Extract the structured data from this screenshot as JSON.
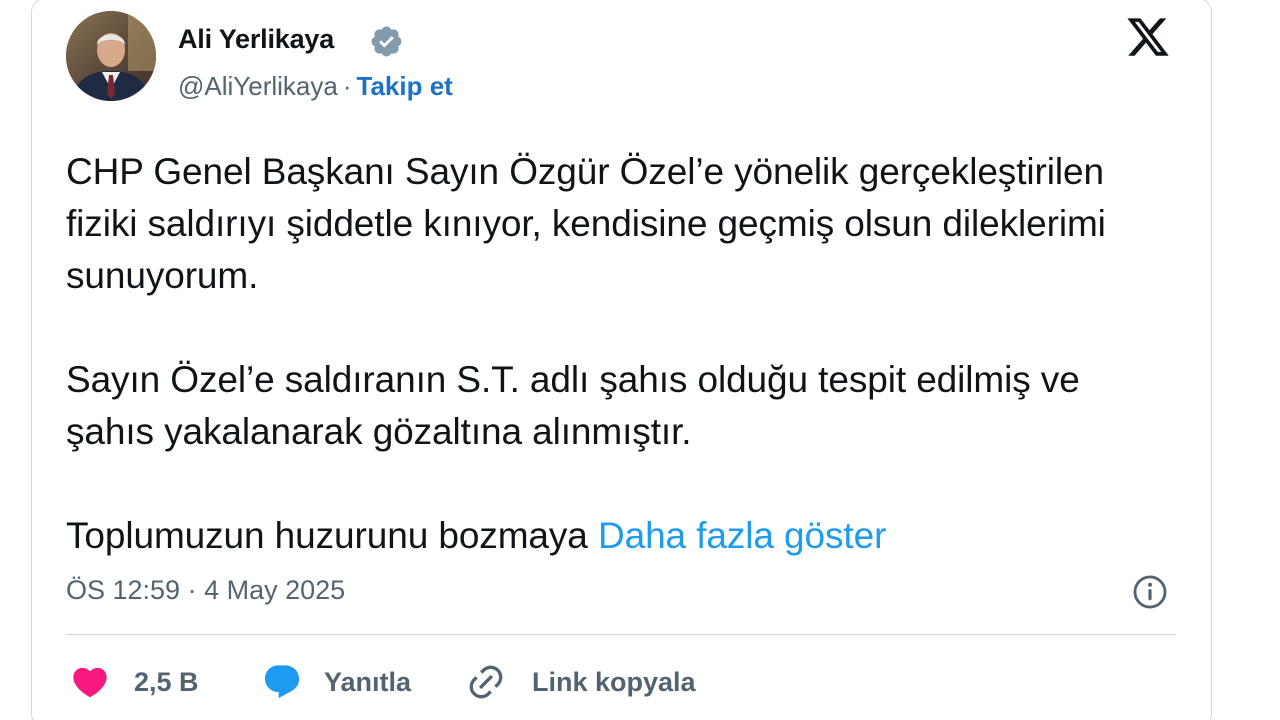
{
  "author": {
    "name": "Ali Yerlikaya",
    "handle": "@AliYerlikaya",
    "separator": "·",
    "follow_label": "Takip et"
  },
  "tweet": {
    "paragraph1": "CHP Genel Başkanı Sayın Özgür Özel’e yönelik gerçekleştirilen fiziki saldırıyı şiddetle kınıyor, kendisine geçmiş olsun dileklerimi sunuyorum.",
    "paragraph2": "Sayın Özel’e saldıranın S.T. adlı şahıs olduğu tespit edilmiş ve şahıs yakalanarak gözaltına alınmıştır.",
    "paragraph3": "Toplumuzun huzurunu bozmaya",
    "show_more_label": "Daha fazla göster",
    "timestamp": "ÖS 12:59 · 4 May 2025"
  },
  "actions": {
    "like_count": "2,5 B",
    "reply_label": "Yanıtla",
    "copy_link_label": "Link kopyala"
  },
  "colors": {
    "accent": "#1d9bf0",
    "like": "#f91880",
    "text": "#0f1419",
    "muted": "#536471",
    "border": "#cfd9de"
  },
  "icons": {
    "verified": "verified-badge-icon",
    "platform": "x-logo-icon",
    "info": "info-icon",
    "like": "heart-icon",
    "reply": "speech-bubble-icon",
    "copy": "link-icon"
  }
}
